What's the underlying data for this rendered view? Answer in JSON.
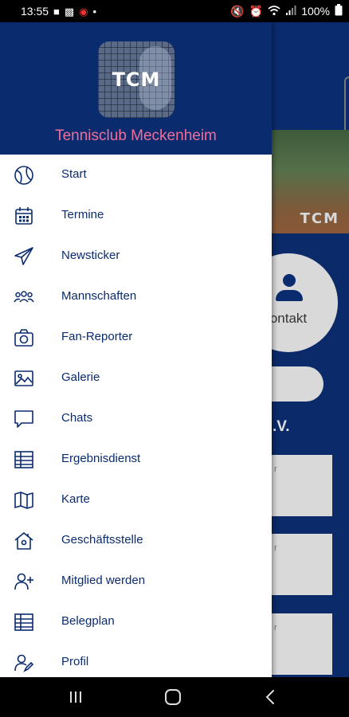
{
  "status_bar": {
    "time": "13:55",
    "battery": "100%",
    "left_icons": [
      "notification-icon",
      "message-icon",
      "record-icon",
      "dot-icon"
    ],
    "right_icons": [
      "mute-icon",
      "alarm-icon",
      "wifi-icon",
      "signal-icon",
      "battery-icon"
    ]
  },
  "drawer": {
    "club_logo_text": "TCM",
    "club_name": "Tennisclub Meckenheim",
    "items": [
      {
        "label": "Start",
        "icon": "tennis-ball-icon"
      },
      {
        "label": "Termine",
        "icon": "calendar-icon"
      },
      {
        "label": "Newsticker",
        "icon": "paper-plane-icon"
      },
      {
        "label": "Mannschaften",
        "icon": "team-icon"
      },
      {
        "label": "Fan-Reporter",
        "icon": "camera-icon"
      },
      {
        "label": "Galerie",
        "icon": "image-icon"
      },
      {
        "label": "Chats",
        "icon": "chat-bubble-icon"
      },
      {
        "label": "Ergebnisdienst",
        "icon": "table-icon"
      },
      {
        "label": "Karte",
        "icon": "map-icon"
      },
      {
        "label": "Geschäftsstelle",
        "icon": "house-icon"
      },
      {
        "label": "Mitglied werden",
        "icon": "add-user-icon"
      },
      {
        "label": "Belegplan",
        "icon": "table-icon"
      },
      {
        "label": "Profil",
        "icon": "user-edit-icon"
      }
    ]
  },
  "background": {
    "photo_logo": "TCM",
    "contact_label": "ontakt",
    "section_text": ".V.",
    "card_snippets": [
      "r",
      "r",
      "r"
    ]
  },
  "colors": {
    "primary": "#0b2b6f",
    "accent": "#ee6f9a",
    "drawer_bg": "#ffffff"
  }
}
